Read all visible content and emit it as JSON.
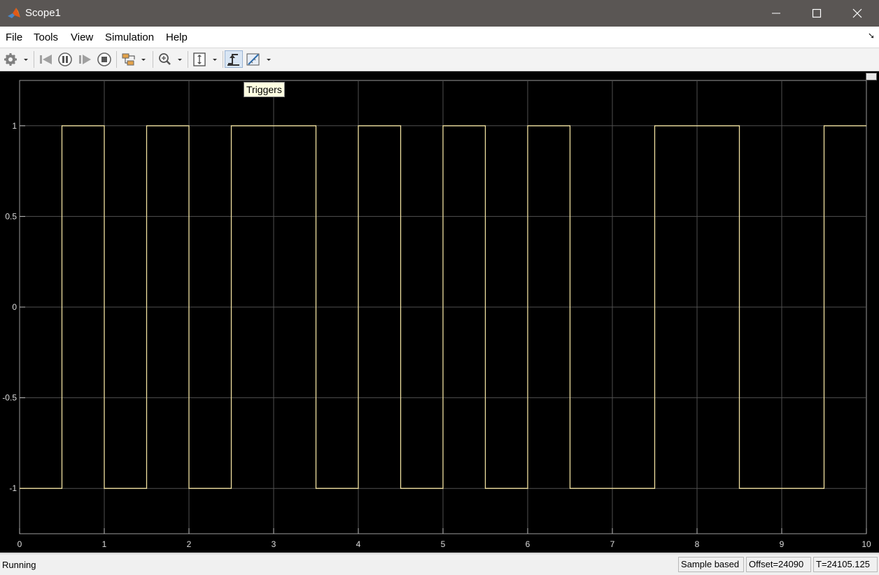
{
  "window": {
    "title": "Scope1"
  },
  "menu": {
    "items": [
      "File",
      "Tools",
      "View",
      "Simulation",
      "Help"
    ]
  },
  "tooltip": "Triggers",
  "status": {
    "state": "Running",
    "mode": "Sample based",
    "offset": "Offset=24090",
    "time": "T=24105.125"
  },
  "colors": {
    "signal": "#f0e0a0",
    "plot_bg": "#000000",
    "grid": "#505050"
  },
  "toolbar_icons": [
    "settings-icon",
    "step-back-icon",
    "pause-icon",
    "step-forward-icon",
    "stop-icon",
    "highlight-block-icon",
    "zoom-in-icon",
    "scale-axes-icon",
    "triggers-icon",
    "cursor-measurements-icon"
  ],
  "chart_data": {
    "type": "line",
    "step": true,
    "xlim": [
      0,
      10
    ],
    "ylim": [
      -1.25,
      1.25
    ],
    "x_ticks": [
      "0",
      "1",
      "2",
      "3",
      "4",
      "5",
      "6",
      "7",
      "8",
      "9",
      "10"
    ],
    "y_ticks": [
      "1",
      "0.5",
      "0",
      "-0.5",
      "-1"
    ],
    "grid": true,
    "series": [
      {
        "x": [
          0,
          0.5,
          0.5,
          1,
          1,
          1.5,
          1.5,
          2,
          2,
          2.5,
          2.5,
          3.5,
          3.5,
          4,
          4,
          4.5,
          4.5,
          5,
          5,
          5.5,
          5.5,
          6,
          6,
          6.5,
          6.5,
          7.5,
          7.5,
          8.5,
          8.5,
          9.5,
          9.5,
          10
        ],
        "y": [
          -1,
          -1,
          1,
          1,
          -1,
          -1,
          1,
          1,
          -1,
          -1,
          1,
          1,
          -1,
          -1,
          1,
          1,
          -1,
          -1,
          1,
          1,
          -1,
          -1,
          1,
          1,
          -1,
          -1,
          1,
          1,
          -1,
          -1,
          1,
          1
        ]
      }
    ]
  }
}
